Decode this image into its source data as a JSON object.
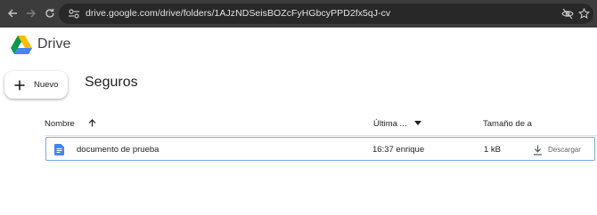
{
  "browser": {
    "url": "drive.google.com/drive/folders/1AJzNDSeisBOZcFyHGbcyPPD2fx5qJ-cv",
    "icons": [
      "back-icon",
      "forward-icon",
      "reload-icon",
      "site-settings-icon",
      "eye-off-icon",
      "star-icon"
    ]
  },
  "app": {
    "title": "Drive"
  },
  "new_button": {
    "label": "Nuevo"
  },
  "folder": {
    "title": "Seguros"
  },
  "table": {
    "columns": {
      "name": "Nombre",
      "modified": "Última ...",
      "size": "Tamaño de a"
    },
    "rows": [
      {
        "name": "documento de prueba",
        "modified": "16:37 enrique",
        "size": "1 kB",
        "action": "Descargar"
      }
    ]
  },
  "colors": {
    "chrome_bg": "#3c3c3c",
    "omnibox_bg": "#282828",
    "doc_blue": "#4285f4",
    "selection_border": "#7aa7e0"
  }
}
